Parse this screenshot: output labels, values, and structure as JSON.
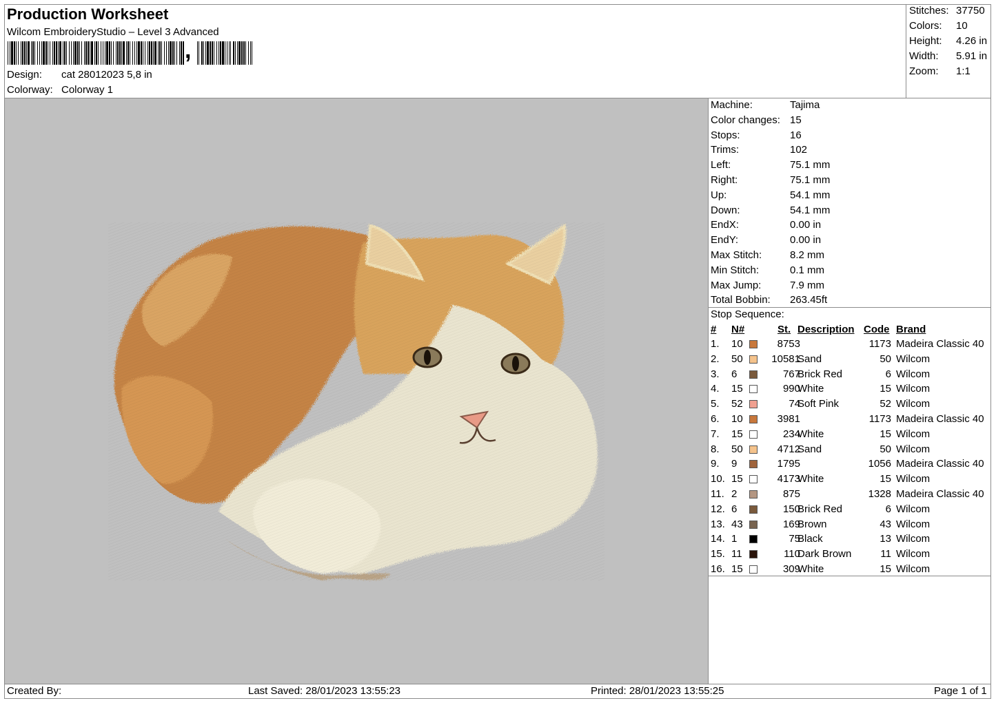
{
  "header": {
    "title": "Production Worksheet",
    "software": "Wilcom EmbroideryStudio – Level 3 Advanced",
    "design_label": "Design:",
    "design_value": "cat 28012023 5,8 in",
    "colorway_label": "Colorway:",
    "colorway_value": "Colorway 1"
  },
  "summary": {
    "stitches_label": "Stitches:",
    "stitches": "37750",
    "colors_label": "Colors:",
    "colors": "10",
    "height_label": "Height:",
    "height": "4.26 in",
    "width_label": "Width:",
    "width": "5.91 in",
    "zoom_label": "Zoom:",
    "zoom": "1:1"
  },
  "machine_info": [
    {
      "label": "Machine:",
      "value": "Tajima"
    },
    {
      "label": "Color changes:",
      "value": "15"
    },
    {
      "label": "Stops:",
      "value": "16"
    },
    {
      "label": "Trims:",
      "value": "102"
    },
    {
      "label": "Left:",
      "value": "75.1 mm"
    },
    {
      "label": "Right:",
      "value": "75.1 mm"
    },
    {
      "label": "Up:",
      "value": "54.1 mm"
    },
    {
      "label": "Down:",
      "value": "54.1 mm"
    },
    {
      "label": "EndX:",
      "value": "0.00 in"
    },
    {
      "label": "EndY:",
      "value": "0.00 in"
    },
    {
      "label": "Max Stitch:",
      "value": "8.2 mm"
    },
    {
      "label": "Min Stitch:",
      "value": "0.1 mm"
    },
    {
      "label": "Max Jump:",
      "value": "7.9 mm"
    },
    {
      "label": "Total Bobbin:",
      "value": "263.45ft"
    }
  ],
  "stop_sequence": {
    "title": "Stop Sequence:",
    "headers": {
      "num": "#",
      "n": "N#",
      "st": "St.",
      "description": "Description",
      "code": "Code",
      "brand": "Brand"
    },
    "rows": [
      {
        "num": "1.",
        "n": "10",
        "color": "#c8783c",
        "st": "8753",
        "description": "",
        "code": "1173",
        "brand": "Madeira Classic 40"
      },
      {
        "num": "2.",
        "n": "50",
        "color": "#f5c38c",
        "st": "10581",
        "description": "Sand",
        "code": "50",
        "brand": "Wilcom"
      },
      {
        "num": "3.",
        "n": "6",
        "color": "#7a5a3c",
        "st": "767",
        "description": "Brick Red",
        "code": "6",
        "brand": "Wilcom"
      },
      {
        "num": "4.",
        "n": "15",
        "color": "#ffffff",
        "st": "990",
        "description": "White",
        "code": "15",
        "brand": "Wilcom"
      },
      {
        "num": "5.",
        "n": "52",
        "color": "#f0a090",
        "st": "74",
        "description": "Soft Pink",
        "code": "52",
        "brand": "Wilcom"
      },
      {
        "num": "6.",
        "n": "10",
        "color": "#c8783c",
        "st": "3981",
        "description": "",
        "code": "1173",
        "brand": "Madeira Classic 40"
      },
      {
        "num": "7.",
        "n": "15",
        "color": "#ffffff",
        "st": "234",
        "description": "White",
        "code": "15",
        "brand": "Wilcom"
      },
      {
        "num": "8.",
        "n": "50",
        "color": "#f5c38c",
        "st": "4712",
        "description": "Sand",
        "code": "50",
        "brand": "Wilcom"
      },
      {
        "num": "9.",
        "n": "9",
        "color": "#a0643c",
        "st": "1795",
        "description": "",
        "code": "1056",
        "brand": "Madeira Classic 40"
      },
      {
        "num": "10.",
        "n": "15",
        "color": "#ffffff",
        "st": "4173",
        "description": "White",
        "code": "15",
        "brand": "Wilcom"
      },
      {
        "num": "11.",
        "n": "2",
        "color": "#b49682",
        "st": "875",
        "description": "",
        "code": "1328",
        "brand": "Madeira Classic 40"
      },
      {
        "num": "12.",
        "n": "6",
        "color": "#7a5a3c",
        "st": "150",
        "description": "Brick Red",
        "code": "6",
        "brand": "Wilcom"
      },
      {
        "num": "13.",
        "n": "43",
        "color": "#786450",
        "st": "169",
        "description": "Brown",
        "code": "43",
        "brand": "Wilcom"
      },
      {
        "num": "14.",
        "n": "1",
        "color": "#000000",
        "st": "75",
        "description": "Black",
        "code": "13",
        "brand": "Wilcom"
      },
      {
        "num": "15.",
        "n": "11",
        "color": "#2a140a",
        "st": "110",
        "description": "Dark Brown",
        "code": "11",
        "brand": "Wilcom"
      },
      {
        "num": "16.",
        "n": "15",
        "color": "#ffffff",
        "st": "309",
        "description": "White",
        "code": "15",
        "brand": "Wilcom"
      }
    ]
  },
  "footer": {
    "created_by": "Created By:",
    "last_saved": "Last Saved: 28/01/2023 13:55:23",
    "printed": "Printed: 28/01/2023 13:55:25",
    "page": "Page 1 of 1"
  }
}
